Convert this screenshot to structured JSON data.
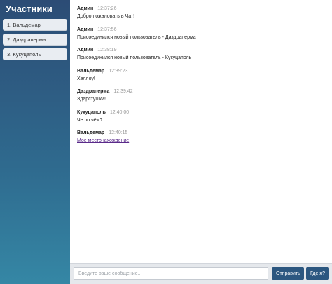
{
  "sidebar": {
    "title": "Участники",
    "members": [
      {
        "label": "1. Вальдемар"
      },
      {
        "label": "2. Даздраперма"
      },
      {
        "label": "3. Кукуцаполь"
      }
    ]
  },
  "messages": [
    {
      "author": "Админ",
      "time": "12:37:26",
      "text": "Добро пожаловать в Чат!"
    },
    {
      "author": "Админ",
      "time": "12:37:56",
      "text": "Присоединился новый пользователь - Даздраперма"
    },
    {
      "author": "Админ",
      "time": "12:38:19",
      "text": "Присоединился новый пользователь - Кукуцаполь"
    },
    {
      "author": "Вальдемар",
      "time": "12:39:23",
      "text": "Хеллоу!"
    },
    {
      "author": "Даздраперма",
      "time": "12:39:42",
      "text": "Здарстушки!"
    },
    {
      "author": "Кукуцаполь",
      "time": "12:40:00",
      "text": "Че по чём?"
    },
    {
      "author": "Вальдемар",
      "time": "12:40:15",
      "link": "Мое местонахождение"
    }
  ],
  "composer": {
    "placeholder": "Введите ваше сообщение...",
    "send_label": "Отправить",
    "where_label": "Где я?"
  }
}
